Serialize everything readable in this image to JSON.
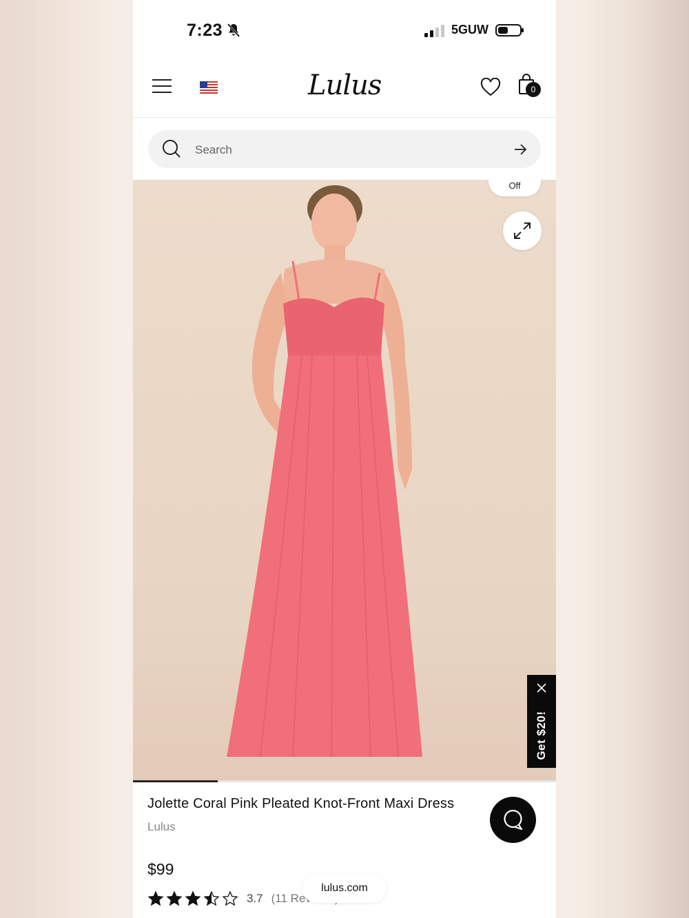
{
  "status_bar": {
    "time": "7:23",
    "network": "5GUW"
  },
  "header": {
    "logo": "Lulus",
    "cart_count": "0"
  },
  "search": {
    "placeholder": "Search"
  },
  "gallery": {
    "size_selector": "Off",
    "progress_fraction": 0.2
  },
  "promo": {
    "label": "Get $20!"
  },
  "product": {
    "title": "Jolette Coral Pink Pleated Knot-Front Maxi Dress",
    "brand": "Lulus",
    "price": "$99",
    "rating_value": "3.7",
    "rating_stars": 3.5,
    "reviews": "(11 Reviews)"
  },
  "browser": {
    "url": "lulus.com"
  },
  "colors": {
    "dress": "#f06f7a",
    "accent": "#111111"
  }
}
